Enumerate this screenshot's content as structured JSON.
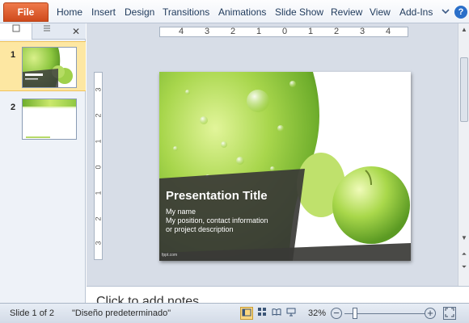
{
  "ribbon": {
    "file_label": "File",
    "tabs": [
      "Home",
      "Insert",
      "Design",
      "Transitions",
      "Animations",
      "Slide Show",
      "Review",
      "View",
      "Add-Ins"
    ],
    "chevron_icon": "chevron-down-icon",
    "help_label": "?"
  },
  "left_pane": {
    "tab_slides_icon": "slides-icon",
    "tab_outline_icon": "outline-icon",
    "close_label": "✕",
    "slides": [
      {
        "number": "1",
        "selected": true
      },
      {
        "number": "2",
        "selected": false
      }
    ]
  },
  "rulers": {
    "horizontal": [
      "4",
      "3",
      "2",
      "1",
      "0",
      "1",
      "2",
      "3",
      "4"
    ],
    "vertical": [
      "3",
      "2",
      "1",
      "0",
      "1",
      "2",
      "3"
    ]
  },
  "slide": {
    "title": "Presentation Title",
    "subtitle_lines": [
      "My name",
      "My position, contact information",
      "or project description"
    ],
    "footer": "fppt.com",
    "accent_green": "#8cc63f",
    "band_color": "#3f3f3f"
  },
  "notes": {
    "placeholder": "Click to add notes"
  },
  "status": {
    "slide_info": "Slide 1 of 2",
    "theme": "\"Diseño predeterminado\"",
    "zoom": "32%",
    "zoom_out": "−",
    "zoom_in": "+"
  }
}
